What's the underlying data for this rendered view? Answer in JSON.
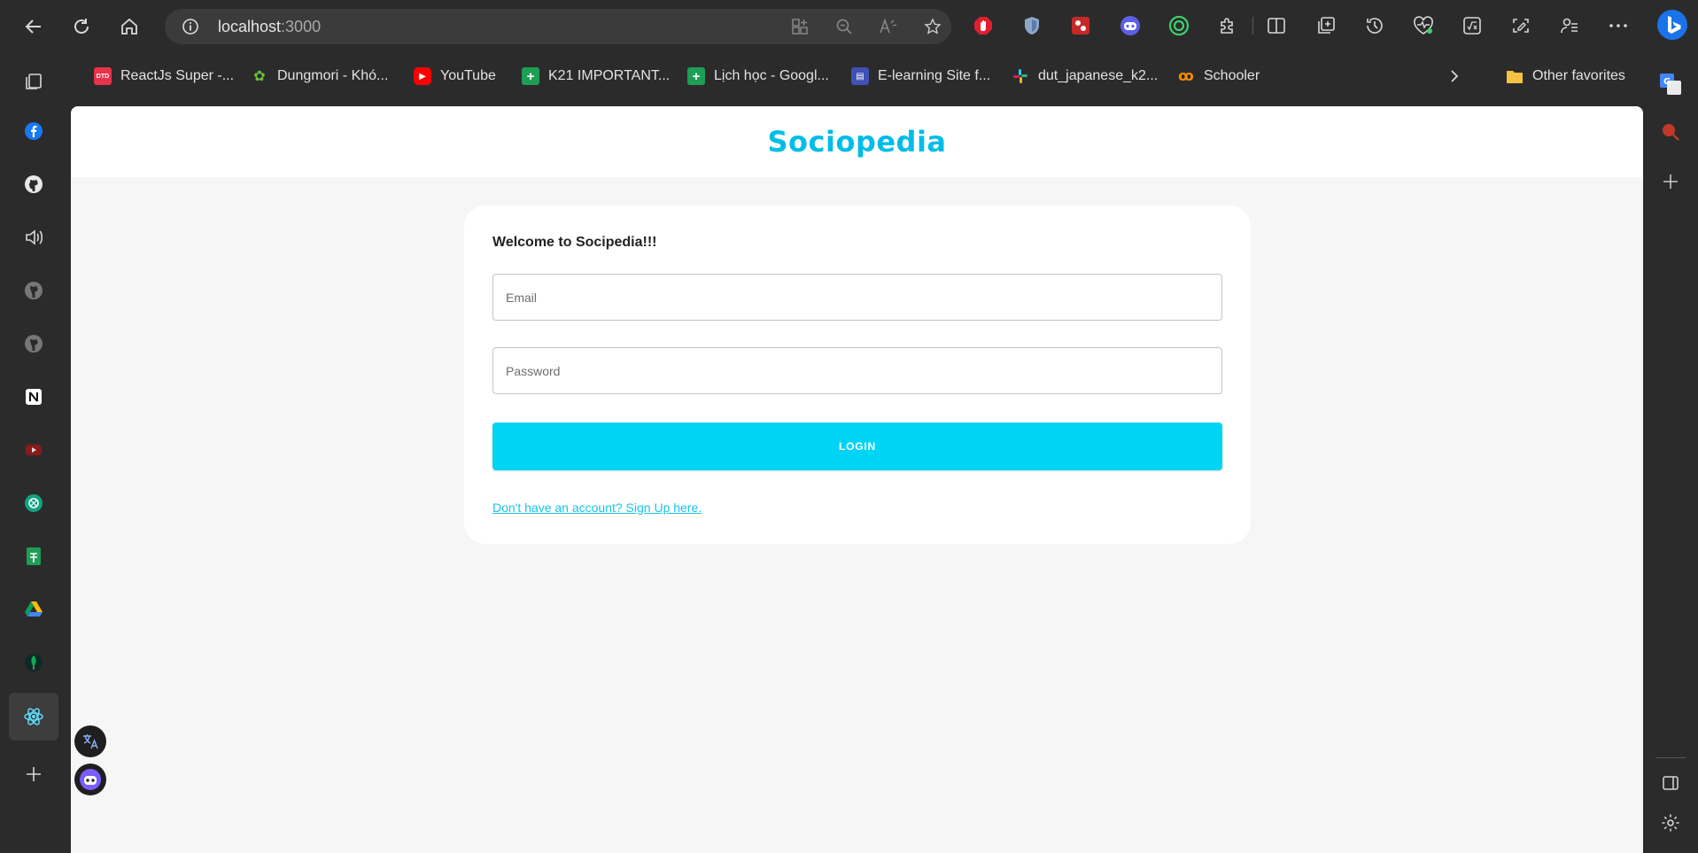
{
  "browser": {
    "url_host": "localhost",
    "url_port": ":3000",
    "favorites": [
      {
        "label": "ReactJs Super -...",
        "icon": "dtd-icon",
        "color": "#e8334a",
        "glyph": "DTD"
      },
      {
        "label": "Dungmori - Khó...",
        "icon": "dungmori-icon",
        "color": "#4caf50",
        "glyph": "✿"
      },
      {
        "label": "YouTube",
        "icon": "youtube-icon",
        "color": "#ff0000",
        "glyph": "▶"
      },
      {
        "label": "K21 IMPORTANT...",
        "icon": "sheets-icon",
        "color": "#1e9e55",
        "glyph": "+"
      },
      {
        "label": "Lịch học - Googl...",
        "icon": "sheets-icon",
        "color": "#1e9e55",
        "glyph": "+"
      },
      {
        "label": "E-learning Site f...",
        "icon": "elearning-icon",
        "color": "#3f51b5",
        "glyph": "▤"
      },
      {
        "label": "dut_japanese_k2...",
        "icon": "slack-icon",
        "color": "#611f69",
        "glyph": "#"
      },
      {
        "label": "Schooler",
        "icon": "schooler-icon",
        "color": "#ff8a00",
        "glyph": "ꝏ"
      }
    ],
    "other_favorites": "Other favorites"
  },
  "app": {
    "brand": "Sociopedia",
    "welcome": "Welcome to Socipedia!!!",
    "email_placeholder": "Email",
    "password_placeholder": "Password",
    "login_label": "LOGIN",
    "signup_link": "Don't have an account? Sign Up here."
  },
  "colors": {
    "brand": "#00bde8",
    "button": "#00d4f5",
    "page_bg": "#f6f6f6",
    "chrome_bg": "#2b2b2b"
  }
}
